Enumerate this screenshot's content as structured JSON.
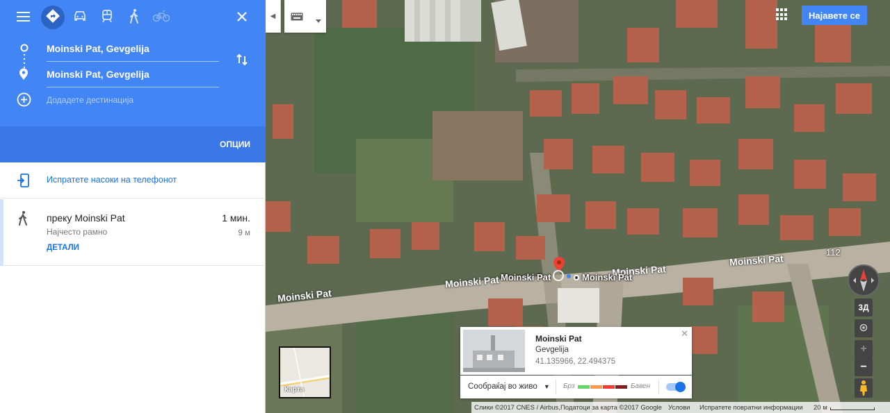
{
  "directions": {
    "modes": [
      {
        "name": "best-route",
        "icon": "directions-icon",
        "active": true
      },
      {
        "name": "driving",
        "icon": "car-icon"
      },
      {
        "name": "transit",
        "icon": "train-icon"
      },
      {
        "name": "walking",
        "icon": "walk-icon"
      },
      {
        "name": "cycling",
        "icon": "bike-icon"
      }
    ],
    "origin": "Moinski Pat, Gevgelija",
    "destination": "Moinski Pat, Gevgelija",
    "add_destination_placeholder": "Додадете дестинација",
    "options_label": "Опции",
    "send_to_phone": "Испратете насоки на телефонот",
    "route": {
      "via": "преку Moinski Pat",
      "summary": "Најчесто рамно",
      "details_label": "Детали",
      "time": "1 мин.",
      "distance": "9 м"
    }
  },
  "map": {
    "sign_in_label": "Најавете се",
    "road_labels": [
      "Moinski Pat",
      "Moinski Pat",
      "Moinski Pat",
      "Moinski Pat"
    ],
    "road_number": "112",
    "pin_labels": [
      "Moinski Pat",
      "Moinski Pat"
    ],
    "view_3d_label": "3Д",
    "zoom_in_label": "+",
    "zoom_out_label": "−",
    "minimap_label": "Карта",
    "info_card": {
      "title": "Moinski Pat",
      "city": "Gevgelija",
      "coordinates": "41.135966, 22.494375"
    },
    "traffic": {
      "live_label": "Сообраќај во живо",
      "fast_label": "Брз",
      "slow_label": "Бавен",
      "legend_colors": [
        "#63d668",
        "#ff974d",
        "#f23c32",
        "#811f1f"
      ],
      "enabled": true
    },
    "footer": {
      "imagery": "Слики ©2017 CNES / Airbus,Податоци за карта ©2017 Google",
      "terms": "Услови",
      "feedback": "Испратете повратни информации",
      "scale": "20 м"
    }
  },
  "colors": {
    "panel_header": "#4285f4",
    "options_bar": "#3b78e7",
    "link": "#1a73e8",
    "pin": "#ea4335"
  }
}
